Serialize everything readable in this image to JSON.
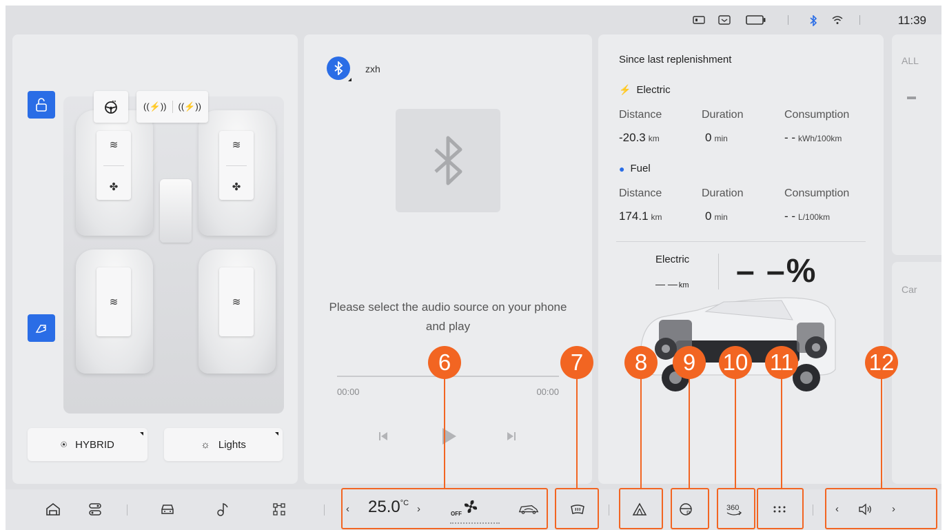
{
  "status_bar": {
    "time": "11:39",
    "icons": [
      "dashcam-icon",
      "message-icon",
      "battery-icon",
      "bluetooth-icon",
      "wifi-icon"
    ]
  },
  "seats": {
    "controls": [
      "unlock-icon",
      "steering-wheel-heat-icon",
      "rear-left-massage-icon",
      "rear-right-massage-icon",
      "fuel-door-icon"
    ],
    "front_left": [
      "seat-heat-icon",
      "seat-ventilation-icon"
    ],
    "front_right": [
      "seat-heat-icon",
      "seat-ventilation-icon"
    ],
    "rear_left": [
      "seat-heat-icon"
    ],
    "rear_right": [
      "seat-heat-icon"
    ],
    "hybrid_label": "HYBRID",
    "lights_label": "Lights"
  },
  "media": {
    "device_name": "zxh",
    "hint": "Please select the audio source on your phone and play",
    "time_elapsed": "00:00",
    "time_total": "00:00",
    "progress": 0
  },
  "trip": {
    "title": "Since last replenishment",
    "electric": {
      "label": "Electric",
      "distance_label": "Distance",
      "duration_label": "Duration",
      "consumption_label": "Consumption",
      "distance": "-20.3",
      "distance_unit": "km",
      "duration": "0",
      "duration_unit": "min",
      "consumption": "- -",
      "consumption_unit": "kWh/100km"
    },
    "fuel": {
      "label": "Fuel",
      "distance_label": "Distance",
      "duration_label": "Duration",
      "consumption_label": "Consumption",
      "distance": "174.1",
      "distance_unit": "km",
      "duration": "0",
      "duration_unit": "min",
      "consumption": "- -",
      "consumption_unit": "L/100km"
    },
    "range_label": "Electric",
    "range_value": "— —",
    "range_unit": "km",
    "battery_percent": "– –%"
  },
  "side_peek": {
    "top": "ALL",
    "bottom": "Car"
  },
  "dock": {
    "left_icons": [
      "home-icon",
      "toggles-icon",
      "car-icon",
      "music-icon",
      "apps-icon"
    ],
    "temperature": "25.0",
    "temp_unit": "°C",
    "fan_state": "OFF",
    "volume_icon": "speaker-icon"
  },
  "annotations": [
    "6",
    "7",
    "8",
    "9",
    "10",
    "11",
    "12"
  ],
  "colors": {
    "accent": "#2a6de6",
    "annotation": "#f26522",
    "electric": "#27b24a",
    "fuel": "#2a6de6"
  }
}
